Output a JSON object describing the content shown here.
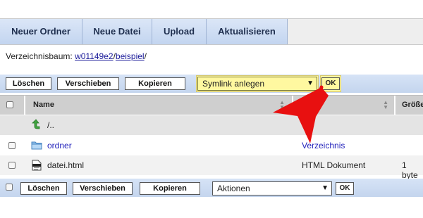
{
  "toolbar": {
    "buttons": [
      "Neuer Ordner",
      "Neue Datei",
      "Upload",
      "Aktualisieren"
    ]
  },
  "breadcrumb": {
    "label": "Verzeichnisbaum: ",
    "parts": [
      "w01149e2",
      "beispiel"
    ],
    "sep": "/"
  },
  "actions_top": {
    "delete": "Löschen",
    "move": "Verschieben",
    "copy": "Kopieren",
    "select_value": "Symlink anlegen",
    "ok": "OK"
  },
  "table": {
    "columns": [
      "Name",
      "Größe"
    ],
    "rows": [
      {
        "name": "/..",
        "type": ""
      },
      {
        "name": "ordner",
        "type": "Verzeichnis",
        "size": ""
      },
      {
        "name": "datei.html",
        "type": "HTML Dokument",
        "size": "1 byte"
      }
    ]
  },
  "actions_bottom": {
    "delete": "Löschen",
    "move": "Verschieben",
    "copy": "Kopieren",
    "select_value": "Aktionen",
    "ok": "OK"
  },
  "colors": {
    "toolbar_button": "#c9d9f2",
    "action_bar": "#cbdaf0",
    "highlight": "#fff8a0",
    "arrow": "#e81010",
    "link": "#2222bb"
  }
}
